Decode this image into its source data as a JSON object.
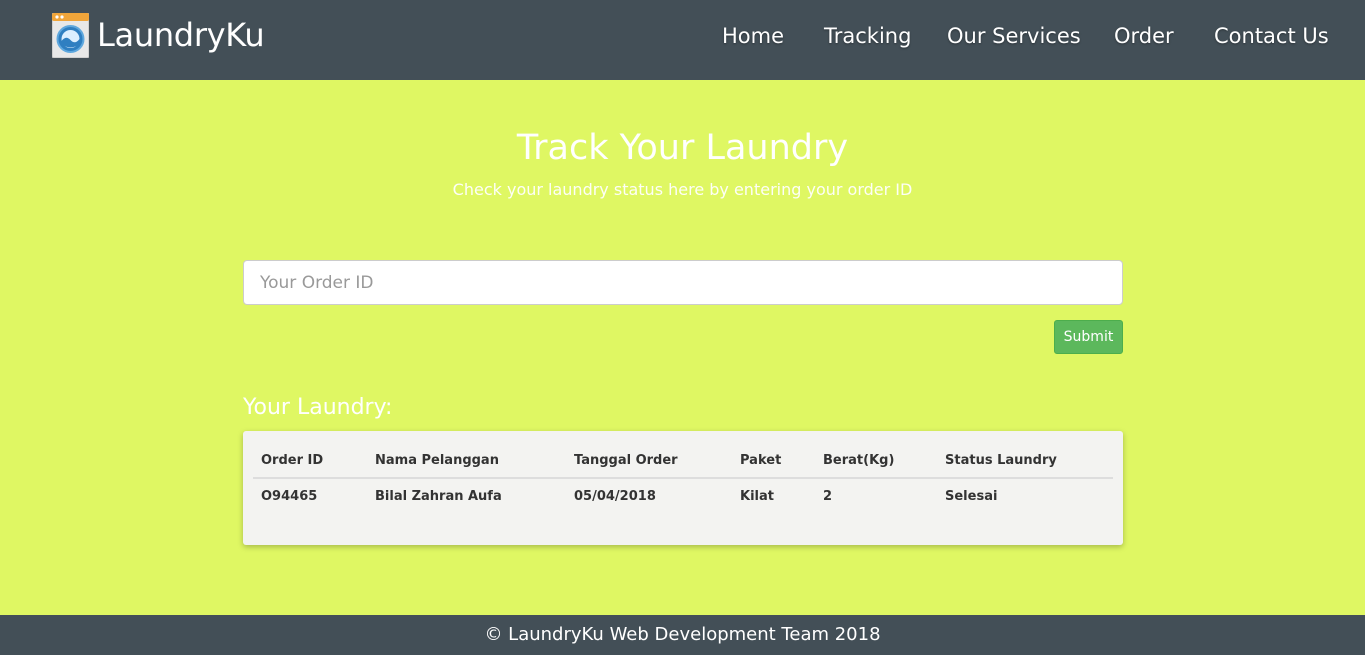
{
  "brand": {
    "name": "LaundryKu",
    "logo_icon": "washing-machine-icon"
  },
  "nav": {
    "items": [
      {
        "label": "Home"
      },
      {
        "label": "Tracking"
      },
      {
        "label": "Our Services"
      },
      {
        "label": "Order"
      },
      {
        "label": "Contact Us"
      }
    ]
  },
  "hero": {
    "title": "Track Your Laundry",
    "subtitle": "Check your laundry status here by entering your order ID"
  },
  "search": {
    "placeholder": "Your Order ID",
    "value": ""
  },
  "submit_label": "Submit",
  "results": {
    "title": "Your Laundry:",
    "columns": [
      "Order ID",
      "Nama Pelanggan",
      "Tanggal Order",
      "Paket",
      "Berat(Kg)",
      "Status Laundry"
    ],
    "rows": [
      [
        "O94465",
        "Bilal Zahran Aufa",
        "05/04/2018",
        "Kilat",
        "2",
        "Selesai"
      ]
    ]
  },
  "footer": {
    "text": "© LaundryKu Web Development Team 2018"
  },
  "colors": {
    "navbar": "#434f57",
    "page_background": "#dff763",
    "submit_button": "#5cb85c",
    "table_card": "#f3f3f1"
  }
}
